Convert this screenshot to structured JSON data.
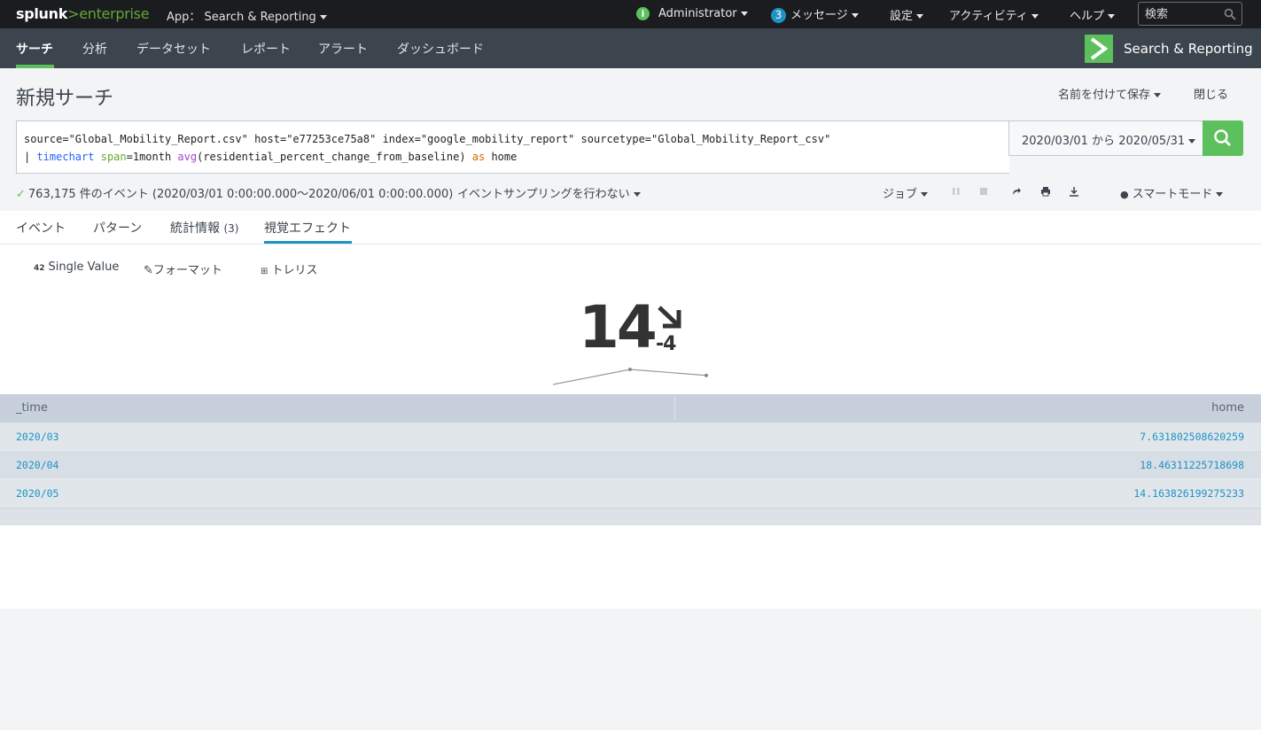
{
  "topbar": {
    "logo_left": "splunk",
    "logo_right": ">enterprise",
    "app_label": "App：",
    "app_name": "Search & Reporting",
    "user": "Administrator",
    "messages_count": "3",
    "messages_label": "メッセージ",
    "settings": "設定",
    "activity": "アクティビティ",
    "help": "ヘルプ",
    "search_placeholder": "検索"
  },
  "nav": {
    "tabs": [
      "サーチ",
      "分析",
      "データセット",
      "レポート",
      "アラート",
      "ダッシュボード"
    ],
    "app_title": "Search & Reporting"
  },
  "header": {
    "title": "新規サーチ",
    "save_as": "名前を付けて保存",
    "close": "閉じる"
  },
  "query": {
    "line1": "source=\"Global_Mobility_Report.csv\" host=\"e77253ce75a8\" index=\"google_mobility_report\" sourcetype=\"Global_Mobility_Report_csv\"",
    "pipe": "| ",
    "cmd": "timechart",
    "arg": "span",
    "arg_value": "=1month ",
    "fn": "avg",
    "fn_args": "(residential_percent_change_from_baseline) ",
    "kw": "as",
    "rest": " home"
  },
  "timerange": "2020/03/01 から 2020/05/31",
  "status": {
    "events": "763,175 件のイベント (2020/03/01 0:00:00.000〜2020/06/01 0:00:00.000)",
    "sampling": "イベントサンプリングを行わない",
    "job": "ジョブ",
    "mode": "スマートモード"
  },
  "subtabs": {
    "events": "イベント",
    "patterns": "パターン",
    "stats": "統計情報",
    "stats_count": "(3)",
    "viz": "視覚エフェクト"
  },
  "viz": {
    "type_badge": "42",
    "type": "Single Value",
    "format": "フォーマット",
    "trellis": "トレリス"
  },
  "single_value": {
    "value": "14",
    "delta": "-4",
    "trend": "down",
    "sparkline": [
      7.631802508620259,
      18.46311225718698,
      14.163826199275233
    ]
  },
  "table": {
    "columns": [
      "_time",
      "home"
    ],
    "rows": [
      [
        "2020/03",
        "7.631802508620259"
      ],
      [
        "2020/04",
        "18.46311225718698"
      ],
      [
        "2020/05",
        "14.163826199275233"
      ]
    ]
  },
  "colors": {
    "accent_green": "#5cc05c",
    "link_blue": "#1e93c6",
    "nav_bg": "#3c444d",
    "top_bg": "#1a1c20"
  }
}
